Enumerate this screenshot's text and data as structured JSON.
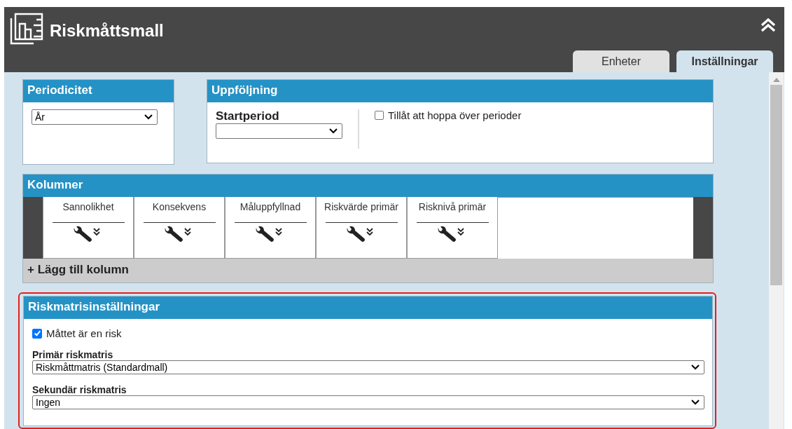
{
  "header": {
    "title": "Riskmåttsmall"
  },
  "tabs": [
    {
      "label": "Enheter",
      "selected": false
    },
    {
      "label": "Inställningar",
      "selected": true
    }
  ],
  "periodicity": {
    "title": "Periodicitet",
    "value": "År"
  },
  "followup": {
    "title": "Uppföljning",
    "start_label": "Startperiod",
    "skip_label": "Tillåt att hoppa över perioder",
    "skip_checked": false
  },
  "columns": {
    "title": "Kolumner",
    "items": [
      "Sannolikhet",
      "Konsekvens",
      "Måluppfyllnad",
      "Riskvärde primär",
      "Risknivå primär"
    ],
    "add_label": "+ Lägg till kolumn"
  },
  "risk_matrix": {
    "title": "Riskmatrisinställningar",
    "is_risk_label": "Måttet är en risk",
    "is_risk_checked": true,
    "highlighted": true,
    "primary_label": "Primär riskmatris",
    "primary_value": "Riskmåttmatris (Standardmall)",
    "secondary_label": "Sekundär riskmatris",
    "secondary_value": "Ingen"
  }
}
